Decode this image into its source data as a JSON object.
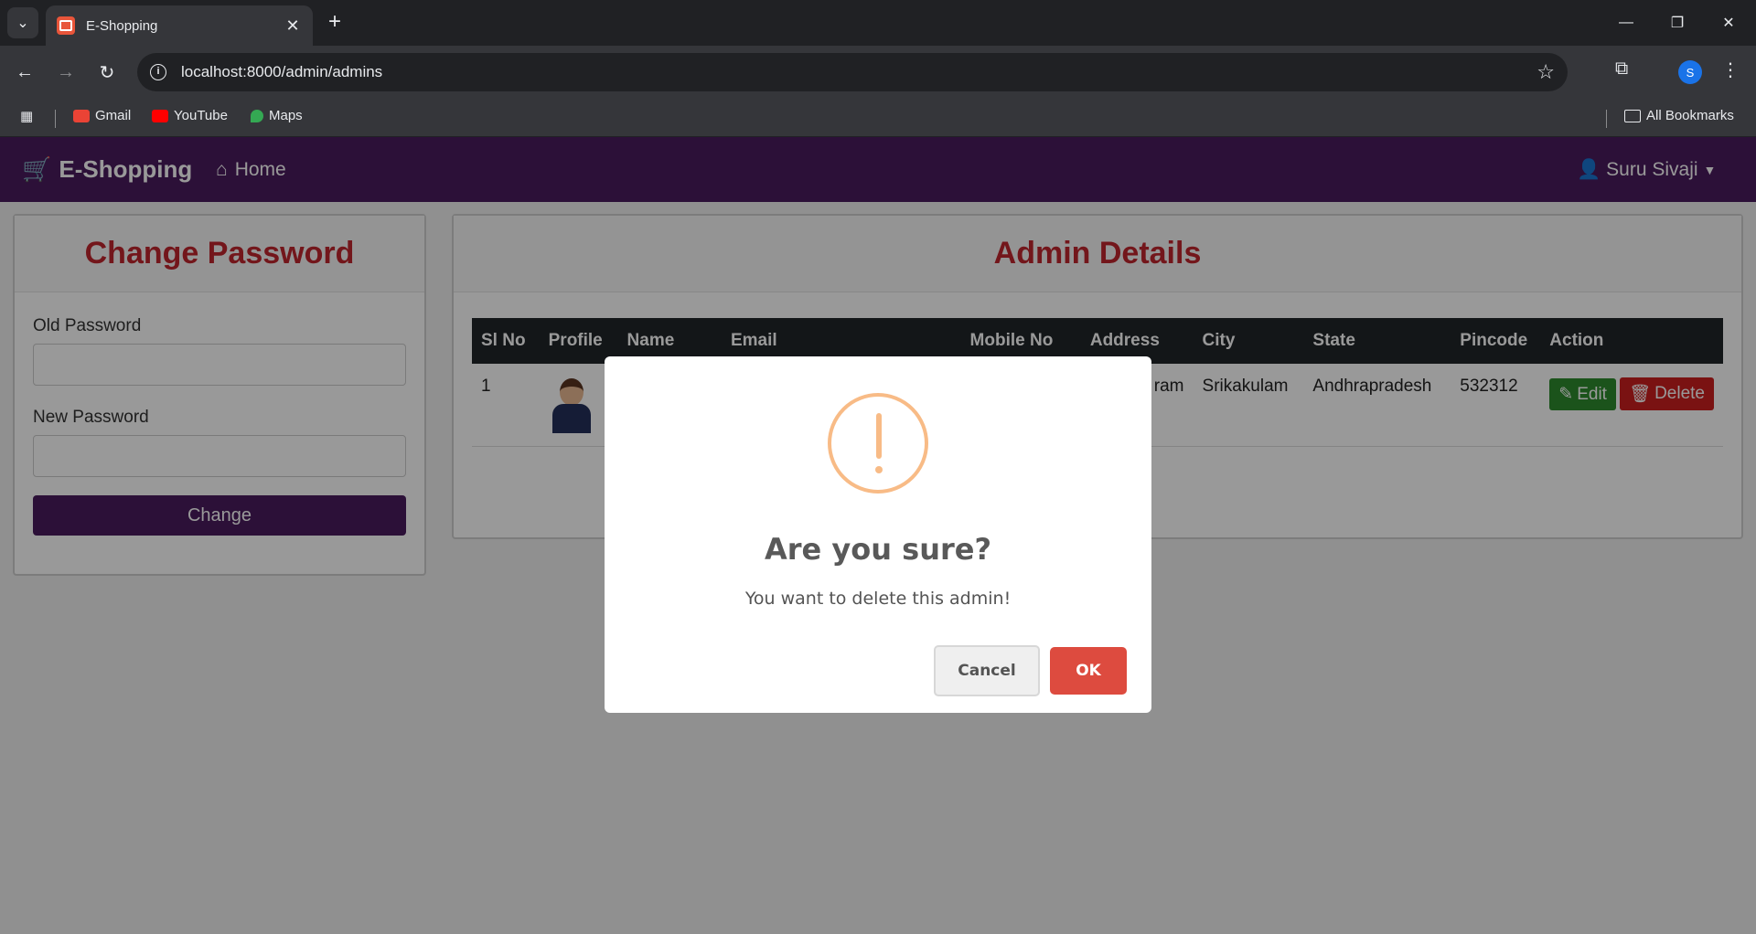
{
  "browser": {
    "tab_title": "E-Shopping",
    "url": "localhost:8000/admin/admins",
    "profile_initial": "S",
    "bookmarks": [
      {
        "label": "Gmail",
        "color": "#ea4335"
      },
      {
        "label": "YouTube",
        "color": "#ff0000"
      },
      {
        "label": "Maps",
        "color": "#34a853"
      }
    ],
    "all_bookmarks": "All Bookmarks"
  },
  "navbar": {
    "brand": "E-Shopping",
    "home": "Home",
    "user": "Suru Sivaji"
  },
  "change_password": {
    "title": "Change Password",
    "old_label": "Old Password",
    "new_label": "New Password",
    "button": "Change"
  },
  "admin_details": {
    "title": "Admin Details",
    "columns": [
      "Sl No",
      "Profile",
      "Name",
      "Email",
      "Mobile No",
      "Address",
      "City",
      "State",
      "Pincode",
      "Action"
    ],
    "rows": [
      {
        "sl": "1",
        "address": "ram",
        "city": "Srikakulam",
        "state": "Andhrapradesh",
        "pincode": "532312",
        "edit": "Edit",
        "delete": "Delete"
      }
    ]
  },
  "dialog": {
    "title": "Are you sure?",
    "text": "You want to delete this admin!",
    "cancel": "Cancel",
    "ok": "OK",
    "icon_color": "#f8bb86",
    "ok_color": "#dd4b3f"
  }
}
